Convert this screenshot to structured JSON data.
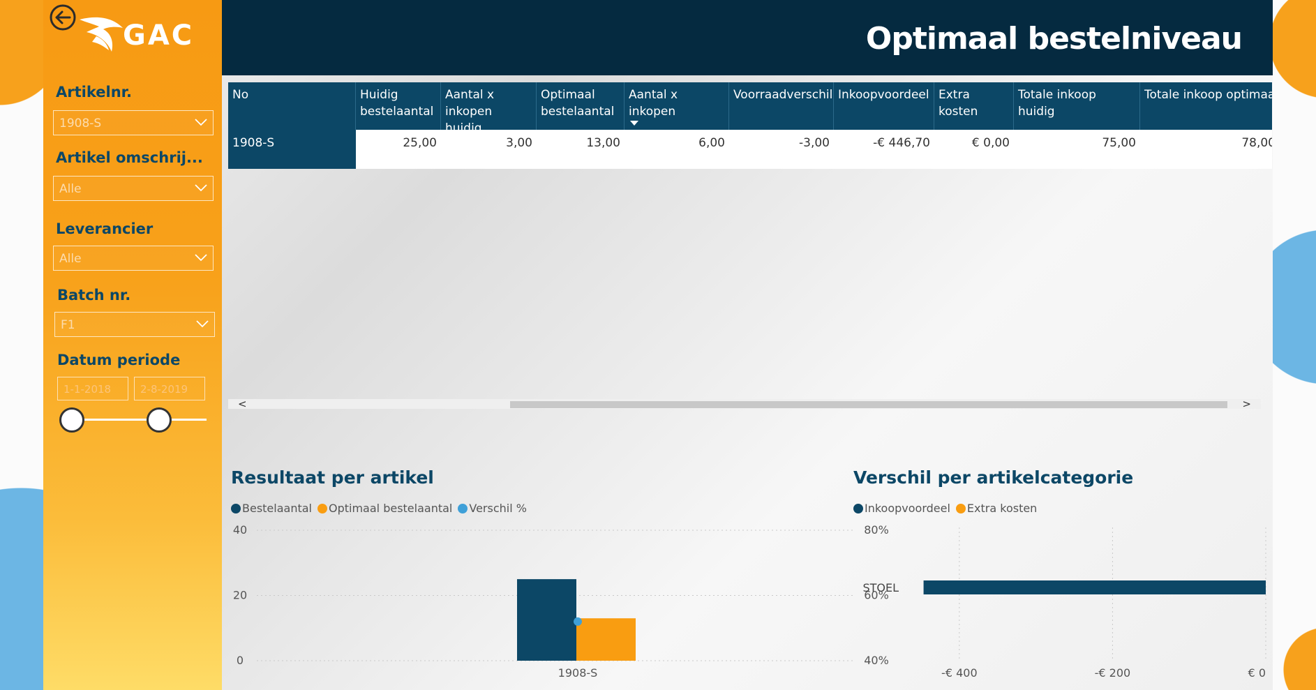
{
  "colors": {
    "navy": "#052a40",
    "primary_blue": "#0c4766",
    "orange": "#f99d11",
    "light_blue": "#3fa0d8"
  },
  "header": {
    "title": "Optimaal bestelniveau"
  },
  "logo": {
    "text": "GAC"
  },
  "sidebar": {
    "back_icon": "arrow-left-circle-icon",
    "filters": [
      {
        "label": "Artikelnr.",
        "value": "1908-S"
      },
      {
        "label": "Artikel omschrij...",
        "value": "Alle"
      },
      {
        "label": "Leverancier",
        "value": "Alle"
      },
      {
        "label": "Batch nr.",
        "value": "F1"
      }
    ],
    "date": {
      "label": "Datum periode",
      "start": "1-1-2018",
      "end": "2-8-2019"
    }
  },
  "table": {
    "columns": [
      "No",
      "Huidig bestelaantal",
      "Aantal x inkopen huidig",
      "Optimaal bestelaantal",
      "Aantal x inkopen",
      "Voorraadverschil",
      "Inkoopvoordeel",
      "Extra kosten",
      "Totale inkoop huidig",
      "Totale inkoop optimaal"
    ],
    "rows": [
      [
        "1908-S",
        "25,00",
        "3,00",
        "13,00",
        "6,00",
        "-3,00",
        "-€ 446,70",
        "€ 0,00",
        "75,00",
        "78,00"
      ]
    ],
    "scroll_left": "<",
    "scroll_right": ">"
  },
  "charts": [
    {
      "title": "Resultaat per artikel",
      "legend": [
        "Bestelaantal",
        "Optimaal bestelaantal",
        "Verschil %"
      ]
    },
    {
      "title": "Verschil per artikelcategorie",
      "legend": [
        "Inkoopvoordeel",
        "Extra kosten"
      ]
    }
  ],
  "chart_data": [
    {
      "type": "bar",
      "title": "Resultaat per artikel",
      "categories": [
        "1908-S"
      ],
      "series": [
        {
          "name": "Bestelaantal",
          "values": [
            25
          ],
          "color": "#0c4766",
          "axis": "left"
        },
        {
          "name": "Optimaal bestelaantal",
          "values": [
            13
          ],
          "color": "#f99d11",
          "axis": "left"
        },
        {
          "name": "Verschil %",
          "values": [
            52
          ],
          "color": "#3fa0d8",
          "axis": "right",
          "style": "point"
        }
      ],
      "ylim": [
        0,
        40
      ],
      "yticks": [
        "40",
        "20",
        "0"
      ],
      "y2lim": [
        40,
        80
      ],
      "y2ticks": [
        "80%",
        "60%",
        "40%"
      ],
      "grid": true,
      "legend_position": "top-left"
    },
    {
      "type": "bar",
      "orientation": "horizontal",
      "title": "Verschil per artikelcategorie",
      "categories": [
        "STOEL"
      ],
      "series": [
        {
          "name": "Inkoopvoordeel",
          "values": [
            -446.7
          ],
          "color": "#0c4766"
        },
        {
          "name": "Extra kosten",
          "values": [
            0
          ],
          "color": "#f99d11"
        }
      ],
      "xlim": [
        -470,
        0
      ],
      "xticks": [
        "-€ 400",
        "-€ 200",
        "€ 0"
      ],
      "xtick_values": [
        -400,
        -200,
        0
      ],
      "grid": true,
      "legend_position": "top-left"
    }
  ]
}
